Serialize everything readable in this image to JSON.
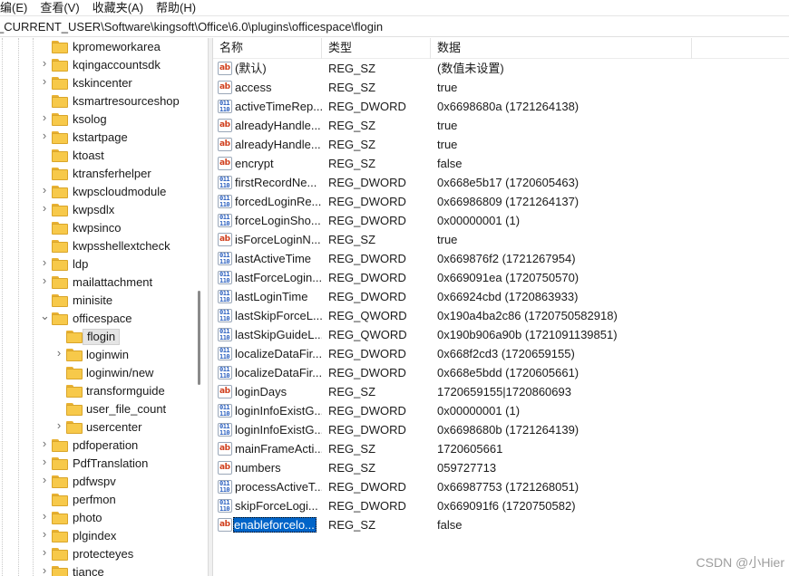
{
  "menu": [
    "编(E)",
    "查看(V)",
    "收藏夹(A)",
    "帮助(H)"
  ],
  "address": "_CURRENT_USER\\Software\\kingsoft\\Office\\6.0\\plugins\\officespace\\flogin",
  "tree": [
    {
      "label": "kpromeworkarea",
      "level": 1,
      "expander": "none"
    },
    {
      "label": "kqingaccountsdk",
      "level": 1,
      "expander": "collapsed"
    },
    {
      "label": "kskincenter",
      "level": 1,
      "expander": "collapsed"
    },
    {
      "label": "ksmartresourceshop",
      "level": 1,
      "expander": "none"
    },
    {
      "label": "ksolog",
      "level": 1,
      "expander": "collapsed"
    },
    {
      "label": "kstartpage",
      "level": 1,
      "expander": "collapsed"
    },
    {
      "label": "ktoast",
      "level": 1,
      "expander": "none"
    },
    {
      "label": "ktransferhelper",
      "level": 1,
      "expander": "none"
    },
    {
      "label": "kwpscloudmodule",
      "level": 1,
      "expander": "collapsed"
    },
    {
      "label": "kwpsdlx",
      "level": 1,
      "expander": "collapsed"
    },
    {
      "label": "kwpsinco",
      "level": 1,
      "expander": "none"
    },
    {
      "label": "kwpsshellextcheck",
      "level": 1,
      "expander": "none"
    },
    {
      "label": "ldp",
      "level": 1,
      "expander": "collapsed"
    },
    {
      "label": "mailattachment",
      "level": 1,
      "expander": "collapsed"
    },
    {
      "label": "minisite",
      "level": 1,
      "expander": "none"
    },
    {
      "label": "officespace",
      "level": 1,
      "expander": "expanded"
    },
    {
      "label": "flogin",
      "level": 2,
      "expander": "none",
      "selected": true
    },
    {
      "label": "loginwin",
      "level": 2,
      "expander": "collapsed"
    },
    {
      "label": "loginwin/new",
      "level": 2,
      "expander": "none"
    },
    {
      "label": "transformguide",
      "level": 2,
      "expander": "none"
    },
    {
      "label": "user_file_count",
      "level": 2,
      "expander": "none"
    },
    {
      "label": "usercenter",
      "level": 2,
      "expander": "collapsed"
    },
    {
      "label": "pdfoperation",
      "level": 1,
      "expander": "collapsed"
    },
    {
      "label": "PdfTranslation",
      "level": 1,
      "expander": "collapsed"
    },
    {
      "label": "pdfwspv",
      "level": 1,
      "expander": "collapsed"
    },
    {
      "label": "perfmon",
      "level": 1,
      "expander": "none"
    },
    {
      "label": "photo",
      "level": 1,
      "expander": "collapsed"
    },
    {
      "label": "plgindex",
      "level": 1,
      "expander": "collapsed"
    },
    {
      "label": "protecteyes",
      "level": 1,
      "expander": "collapsed"
    },
    {
      "label": "tiance",
      "level": 1,
      "expander": "collapsed"
    }
  ],
  "columns": {
    "name": "名称",
    "type": "类型",
    "data": "数据"
  },
  "values": [
    {
      "icon": "string",
      "name": "(默认)",
      "type": "REG_SZ",
      "data": "(数值未设置)"
    },
    {
      "icon": "string",
      "name": "access",
      "type": "REG_SZ",
      "data": "true"
    },
    {
      "icon": "binary",
      "name": "activeTimeRep...",
      "type": "REG_DWORD",
      "data": "0x6698680a (1721264138)"
    },
    {
      "icon": "string",
      "name": "alreadyHandle...",
      "type": "REG_SZ",
      "data": "true"
    },
    {
      "icon": "string",
      "name": "alreadyHandle...",
      "type": "REG_SZ",
      "data": "true"
    },
    {
      "icon": "string",
      "name": "encrypt",
      "type": "REG_SZ",
      "data": "false"
    },
    {
      "icon": "binary",
      "name": "firstRecordNe...",
      "type": "REG_DWORD",
      "data": "0x668e5b17 (1720605463)"
    },
    {
      "icon": "binary",
      "name": "forcedLoginRe...",
      "type": "REG_DWORD",
      "data": "0x66986809 (1721264137)"
    },
    {
      "icon": "binary",
      "name": "forceLoginSho...",
      "type": "REG_DWORD",
      "data": "0x00000001 (1)"
    },
    {
      "icon": "string",
      "name": "isForceLoginN...",
      "type": "REG_SZ",
      "data": "true"
    },
    {
      "icon": "binary",
      "name": "lastActiveTime",
      "type": "REG_DWORD",
      "data": "0x669876f2 (1721267954)"
    },
    {
      "icon": "binary",
      "name": "lastForceLogin...",
      "type": "REG_DWORD",
      "data": "0x669091ea (1720750570)"
    },
    {
      "icon": "binary",
      "name": "lastLoginTime",
      "type": "REG_DWORD",
      "data": "0x66924cbd (1720863933)"
    },
    {
      "icon": "binary",
      "name": "lastSkipForceL...",
      "type": "REG_QWORD",
      "data": "0x190a4ba2c86 (1720750582918)"
    },
    {
      "icon": "binary",
      "name": "lastSkipGuideL...",
      "type": "REG_QWORD",
      "data": "0x190b906a90b (1721091139851)"
    },
    {
      "icon": "binary",
      "name": "localizeDataFir...",
      "type": "REG_DWORD",
      "data": "0x668f2cd3 (1720659155)"
    },
    {
      "icon": "binary",
      "name": "localizeDataFir...",
      "type": "REG_DWORD",
      "data": "0x668e5bdd (1720605661)"
    },
    {
      "icon": "string",
      "name": "loginDays",
      "type": "REG_SZ",
      "data": "1720659155|1720860693"
    },
    {
      "icon": "binary",
      "name": "loginInfoExistG...",
      "type": "REG_DWORD",
      "data": "0x00000001 (1)"
    },
    {
      "icon": "binary",
      "name": "loginInfoExistG...",
      "type": "REG_DWORD",
      "data": "0x6698680b (1721264139)"
    },
    {
      "icon": "string",
      "name": "mainFrameActi...",
      "type": "REG_SZ",
      "data": "1720605661"
    },
    {
      "icon": "string",
      "name": "numbers",
      "type": "REG_SZ",
      "data": "059727713"
    },
    {
      "icon": "binary",
      "name": "processActiveT...",
      "type": "REG_DWORD",
      "data": "0x66987753 (1721268051)"
    },
    {
      "icon": "binary",
      "name": "skipForceLogi...",
      "type": "REG_DWORD",
      "data": "0x669091f6 (1720750582)"
    },
    {
      "icon": "string",
      "name": "enableforcelo...",
      "type": "REG_SZ",
      "data": "false",
      "selected": true
    }
  ],
  "icon_glyphs": {
    "string": "ab",
    "binary_top": "011",
    "binary_bottom": "110"
  },
  "watermark": "CSDN @小Hier",
  "colors": {
    "selection": "#0064c8",
    "folder": "#f7c94a",
    "string_icon": "#d0401e",
    "binary_icon": "#2a5fbf"
  }
}
